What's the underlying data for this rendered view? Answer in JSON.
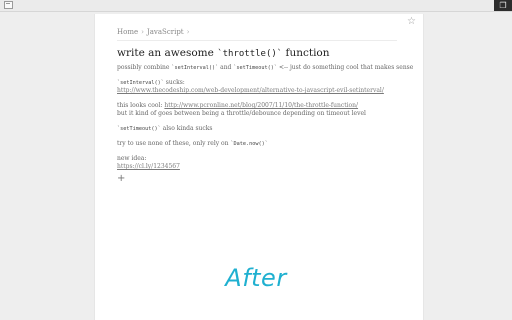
{
  "window": {
    "controls_glyph": "❐"
  },
  "breadcrumb": {
    "home": "Home",
    "separator": "›",
    "section": "JavaScript",
    "trail": "›"
  },
  "note": {
    "title_prefix": "write an awesome ",
    "title_code": "`throttle()`",
    "title_suffix": " function",
    "lines": {
      "l1_a": "possibly combine ",
      "l1_code1": "`setInterval()`",
      "l1_b": " and ",
      "l1_code2": "`setTimeout()`",
      "l1_c": " <-- just do something cool that makes sense",
      "l2_code": "`setInterval()`",
      "l2_b": " sucks:",
      "l3_link": "http://www.thecodeship.com/web-development/alternative-to-javascript-evil-setinterval/",
      "l4_a": "this looks cool: ",
      "l4_link": "http://www.pcronline.net/blog/2007/11/10/the-throttle-function/",
      "l5": "but it kind of goes between being a throttle/debounce depending on timeout level",
      "l6_code": "`setTimeout()`",
      "l6_b": " also kinda sucks",
      "l7_a": "try to use none of these, only rely on ",
      "l7_code": "`Date.now()`",
      "l8": "new idea:",
      "l9_link": "https://cl.ly/1234567",
      "plus": "+"
    }
  },
  "overlay": {
    "label": "After",
    "color": "#1fb0d0"
  }
}
